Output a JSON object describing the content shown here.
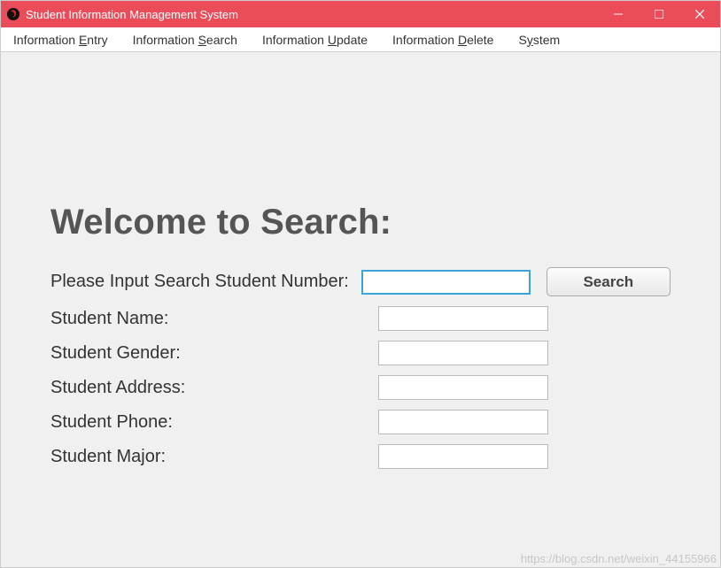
{
  "window": {
    "title": "Student Information Management System"
  },
  "menubar": {
    "items": [
      {
        "pre": "Information ",
        "ul": "E",
        "post": "ntry"
      },
      {
        "pre": "Information ",
        "ul": "S",
        "post": "earch"
      },
      {
        "pre": "Information ",
        "ul": "U",
        "post": "pdate"
      },
      {
        "pre": "Information ",
        "ul": "D",
        "post": "elete"
      },
      {
        "pre": "S",
        "ul": "y",
        "post": "stem"
      }
    ]
  },
  "main": {
    "heading": "Welcome to Search:",
    "search_label": "Please Input Search Student Number:",
    "search_value": "",
    "search_button": "Search",
    "fields": [
      {
        "label": "Student Name:",
        "value": ""
      },
      {
        "label": "Student Gender:",
        "value": ""
      },
      {
        "label": "Student Address:",
        "value": ""
      },
      {
        "label": "Student Phone:",
        "value": ""
      },
      {
        "label": "Student Major:",
        "value": ""
      }
    ]
  },
  "watermark": "https://blog.csdn.net/weixin_44155966"
}
